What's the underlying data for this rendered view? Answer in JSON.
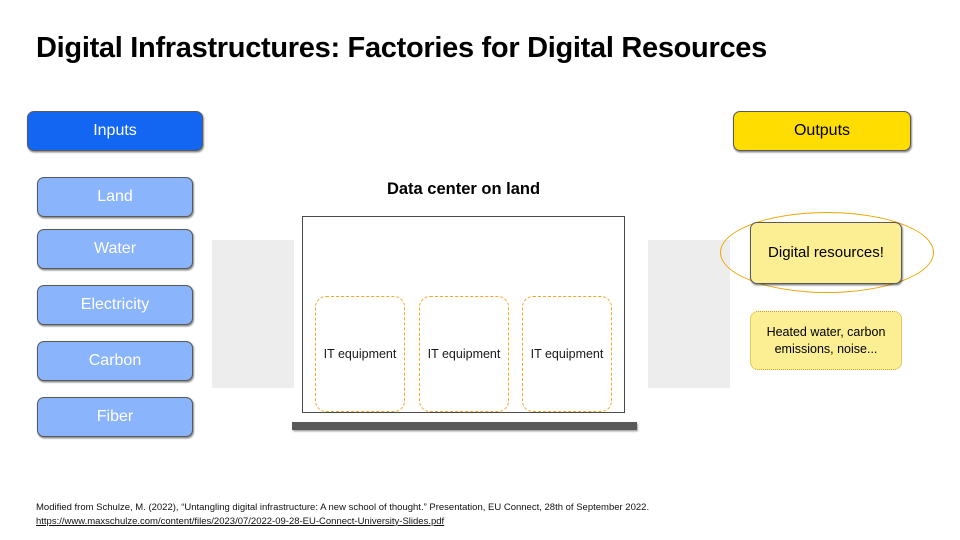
{
  "slide": {
    "title": "Digital Infrastructures: Factories for Digital Resources"
  },
  "inputs": {
    "header_label": "Inputs",
    "header_color": "#1266F1",
    "item_color": "#8AB4FC",
    "items": [
      {
        "label": "Land"
      },
      {
        "label": "Water"
      },
      {
        "label": "Electricity"
      },
      {
        "label": "Carbon"
      },
      {
        "label": "Fiber"
      }
    ]
  },
  "center": {
    "heading": "Data center on land",
    "equipment": [
      {
        "label": "IT equipment"
      },
      {
        "label": "IT equipment"
      },
      {
        "label": "IT equipment"
      }
    ],
    "equipment_border_color": "#F5A623",
    "ground_color": "#595959"
  },
  "arrows": {
    "color": "#EDEDED",
    "left_name": "inputs-to-datacenter",
    "right_name": "datacenter-to-outputs"
  },
  "outputs": {
    "header_label": "Outputs",
    "header_color": "#FFDD00",
    "primary_label": "Digital resources!",
    "byproducts_label": "Heated water, carbon emissions, noise...",
    "box_color": "#FCEE93",
    "highlight_color": "#F0A500"
  },
  "footer": {
    "citation": "Modified from Schulze, M. (2022), “Untangling digital infrastructure: A new school of thought.” Presentation, EU Connect, 28th of September 2022.",
    "url": "https://www.maxschulze.com/content/files/2023/07/2022-09-28-EU-Connect-University-Slides.pdf"
  }
}
